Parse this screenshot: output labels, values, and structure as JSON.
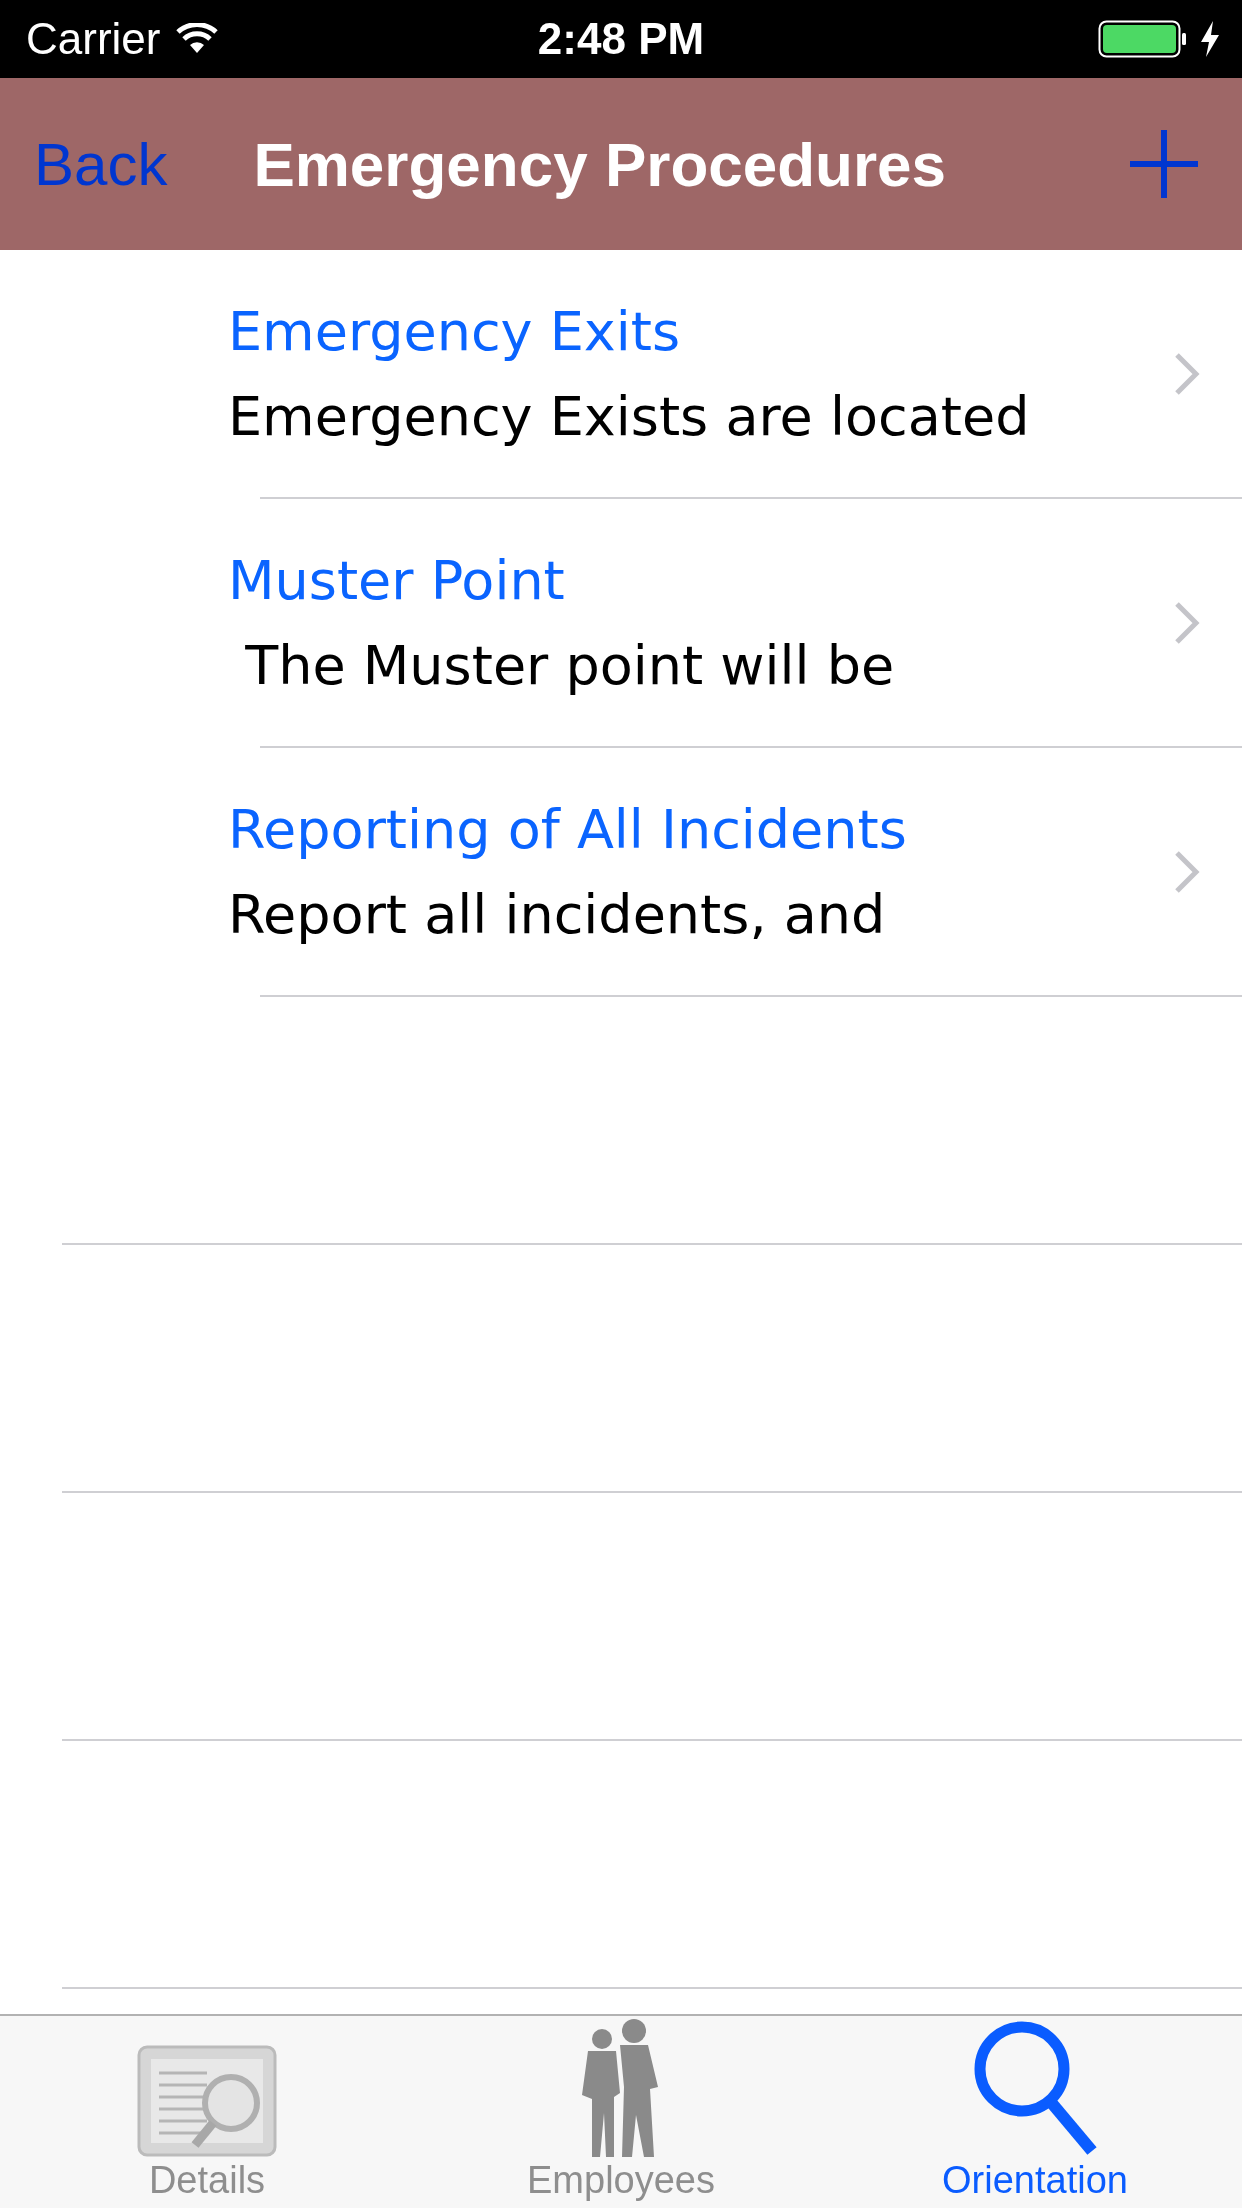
{
  "status_bar": {
    "carrier": "Carrier",
    "time": "2:48 PM"
  },
  "nav_bar": {
    "back": "Back",
    "title": "Emergency Procedures"
  },
  "items": [
    {
      "title": "Emergency Exits",
      "subtitle": "Emergency Exists are located"
    },
    {
      "title": "Muster Point",
      "subtitle": " The Muster point will be"
    },
    {
      "title": "Reporting of All Incidents",
      "subtitle": "Report all incidents, and"
    }
  ],
  "tabs": [
    {
      "label": "Details",
      "kind": "details",
      "selected": false
    },
    {
      "label": "Employees",
      "kind": "employees",
      "selected": false
    },
    {
      "label": "Orientation",
      "kind": "search",
      "selected": true
    }
  ]
}
